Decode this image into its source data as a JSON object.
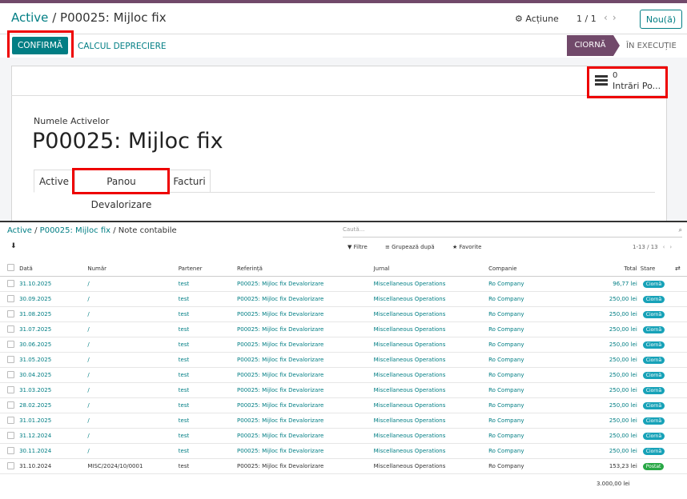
{
  "header": {
    "breadcrumb_parent": "Active",
    "breadcrumb_sep": "/",
    "breadcrumb_current": "P00025: Mijloc fix",
    "action_label": "⚙ Acțiune",
    "pager": "1 / 1",
    "new_button": "Nou(ă)"
  },
  "actionbar": {
    "confirm_label": "CONFIRMĂ",
    "calc_label": "CALCUL DEPRECIERE",
    "status_draft": "CIORNĂ",
    "status_running": "ÎN EXECUȚIE"
  },
  "form": {
    "smart_count": "0",
    "smart_label": "Intrări Po...",
    "name_label": "Numele Activelor",
    "asset_name": "P00025: Mijloc fix",
    "tabs": [
      "Active",
      "Panou Devalorizare",
      "Facturi"
    ]
  },
  "list": {
    "breadcrumb_1": "Active",
    "breadcrumb_2": "P00025: Mijloc fix",
    "breadcrumb_3": "Note contabile",
    "search_placeholder": "Caută...",
    "filter_label": "Filtre",
    "group_label": "Grupează după",
    "fav_label": "Favorite",
    "pager": "1-13 / 13",
    "columns": [
      "Dată",
      "Număr",
      "Partener",
      "Referință",
      "Jurnal",
      "Companie",
      "Total",
      "Stare"
    ],
    "rows": [
      {
        "date": "31.10.2025",
        "num": "/",
        "partner": "test",
        "ref": "P00025: Mijloc fix Devalorizare",
        "journal": "Miscellaneous Operations",
        "company": "Ro Company",
        "total": "96,77 lei",
        "state": "Ciornă"
      },
      {
        "date": "30.09.2025",
        "num": "/",
        "partner": "test",
        "ref": "P00025: Mijloc fix Devalorizare",
        "journal": "Miscellaneous Operations",
        "company": "Ro Company",
        "total": "250,00 lei",
        "state": "Ciornă"
      },
      {
        "date": "31.08.2025",
        "num": "/",
        "partner": "test",
        "ref": "P00025: Mijloc fix Devalorizare",
        "journal": "Miscellaneous Operations",
        "company": "Ro Company",
        "total": "250,00 lei",
        "state": "Ciornă"
      },
      {
        "date": "31.07.2025",
        "num": "/",
        "partner": "test",
        "ref": "P00025: Mijloc fix Devalorizare",
        "journal": "Miscellaneous Operations",
        "company": "Ro Company",
        "total": "250,00 lei",
        "state": "Ciornă"
      },
      {
        "date": "30.06.2025",
        "num": "/",
        "partner": "test",
        "ref": "P00025: Mijloc fix Devalorizare",
        "journal": "Miscellaneous Operations",
        "company": "Ro Company",
        "total": "250,00 lei",
        "state": "Ciornă"
      },
      {
        "date": "31.05.2025",
        "num": "/",
        "partner": "test",
        "ref": "P00025: Mijloc fix Devalorizare",
        "journal": "Miscellaneous Operations",
        "company": "Ro Company",
        "total": "250,00 lei",
        "state": "Ciornă"
      },
      {
        "date": "30.04.2025",
        "num": "/",
        "partner": "test",
        "ref": "P00025: Mijloc fix Devalorizare",
        "journal": "Miscellaneous Operations",
        "company": "Ro Company",
        "total": "250,00 lei",
        "state": "Ciornă"
      },
      {
        "date": "31.03.2025",
        "num": "/",
        "partner": "test",
        "ref": "P00025: Mijloc fix Devalorizare",
        "journal": "Miscellaneous Operations",
        "company": "Ro Company",
        "total": "250,00 lei",
        "state": "Ciornă"
      },
      {
        "date": "28.02.2025",
        "num": "/",
        "partner": "test",
        "ref": "P00025: Mijloc fix Devalorizare",
        "journal": "Miscellaneous Operations",
        "company": "Ro Company",
        "total": "250,00 lei",
        "state": "Ciornă"
      },
      {
        "date": "31.01.2025",
        "num": "/",
        "partner": "test",
        "ref": "P00025: Mijloc fix Devalorizare",
        "journal": "Miscellaneous Operations",
        "company": "Ro Company",
        "total": "250,00 lei",
        "state": "Ciornă"
      },
      {
        "date": "31.12.2024",
        "num": "/",
        "partner": "test",
        "ref": "P00025: Mijloc fix Devalorizare",
        "journal": "Miscellaneous Operations",
        "company": "Ro Company",
        "total": "250,00 lei",
        "state": "Ciornă"
      },
      {
        "date": "30.11.2024",
        "num": "/",
        "partner": "test",
        "ref": "P00025: Mijloc fix Devalorizare",
        "journal": "Miscellaneous Operations",
        "company": "Ro Company",
        "total": "250,00 lei",
        "state": "Ciornă"
      },
      {
        "date": "31.10.2024",
        "num": "MISC/2024/10/0001",
        "partner": "test",
        "ref": "P00025: Mijloc fix Devalorizare",
        "journal": "Miscellaneous Operations",
        "company": "Ro Company",
        "total": "153,23 lei",
        "state": "Postat"
      }
    ],
    "grand_total": "3.000,00 lei"
  },
  "colors": {
    "primary": "#017e84",
    "draft_status": "#71496a",
    "highlight": "#ee0000",
    "badge_draft": "#17a2b8",
    "badge_posted": "#28a745"
  }
}
